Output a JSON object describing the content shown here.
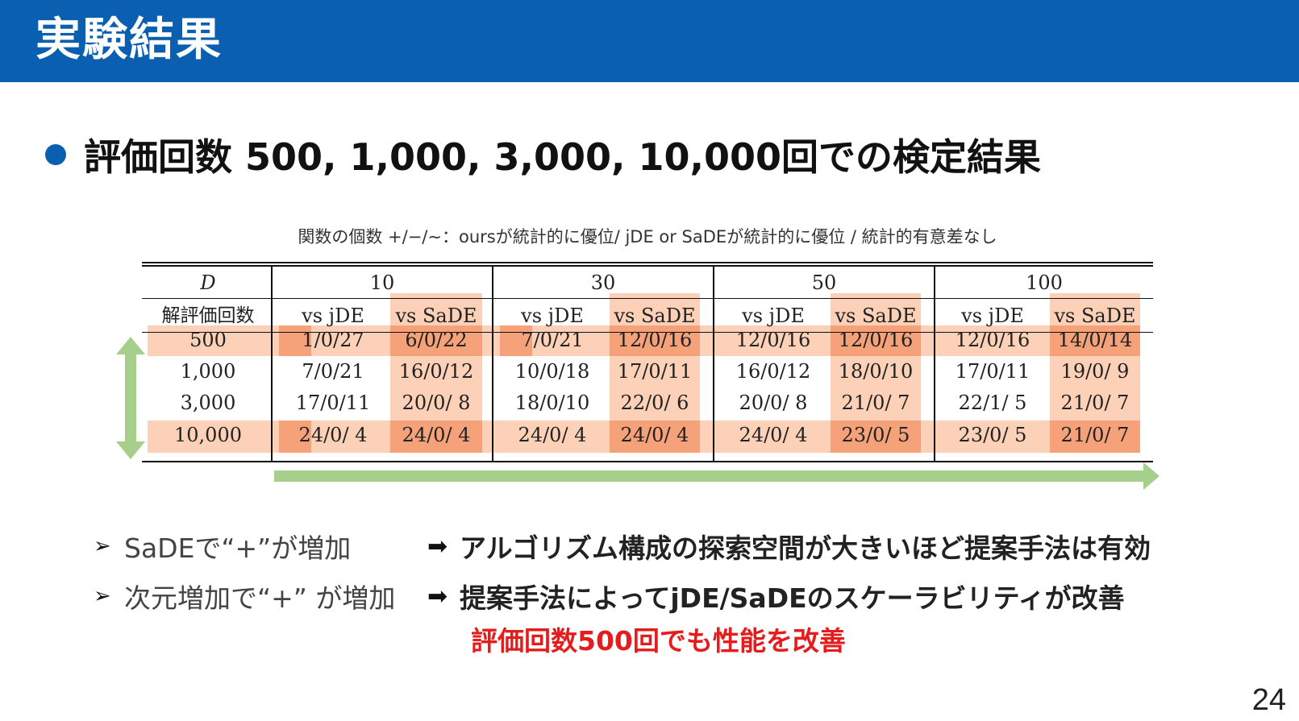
{
  "colors": {
    "header_bg": "#0a5fb0",
    "highlight_light": "#fdd1b8",
    "highlight_dark": "#f5a27a",
    "arrow_green": "#a7cf8c",
    "note_red": "#e61b1b"
  },
  "slide": {
    "title": "実験結果",
    "main_bullet": "評価回数 500, 1,000, 3,000, 10,000回での検定結果",
    "page_number": "24"
  },
  "table": {
    "caption": "関数の個数 +/−/∼：oursが統計的に優位/ jDE or SaDEが統計的に優位 / 統計的有意差なし",
    "corner_label": "D",
    "row_header_label": "解評価回数",
    "dimensions": [
      "10",
      "30",
      "50",
      "100"
    ],
    "comparisons": [
      "vs jDE",
      "vs SaDE"
    ],
    "rows": [
      {
        "evals": "500",
        "cells": [
          "1/0/27",
          "6/0/22",
          "7/0/21",
          "12/0/16",
          "12/0/16",
          "12/0/16",
          "12/0/16",
          "14/0/14"
        ]
      },
      {
        "evals": "1,000",
        "cells": [
          "7/0/21",
          "16/0/12",
          "10/0/18",
          "17/0/11",
          "16/0/12",
          "18/0/10",
          "17/0/11",
          "19/0/ 9"
        ]
      },
      {
        "evals": "3,000",
        "cells": [
          "17/0/11",
          "20/0/ 8",
          "18/0/10",
          "22/0/ 6",
          "20/0/ 8",
          "21/0/ 7",
          "22/1/ 5",
          "21/0/ 7"
        ]
      },
      {
        "evals": "10,000",
        "cells": [
          "24/0/ 4",
          "24/0/ 4",
          "24/0/ 4",
          "24/0/ 4",
          "24/0/ 4",
          "23/0/ 5",
          "23/0/ 5",
          "21/0/ 7"
        ]
      }
    ]
  },
  "findings": [
    {
      "observation": "SaDEで“+”が増加",
      "conclusion": "アルゴリズム構成の探索空間が大きいほど提案手法は有効"
    },
    {
      "observation": "次元増加で“+” が増加",
      "conclusion": "提案手法によってjDE/SaDEのスケーラビリティが改善"
    }
  ],
  "note": "評価回数500回でも性能を改善"
}
